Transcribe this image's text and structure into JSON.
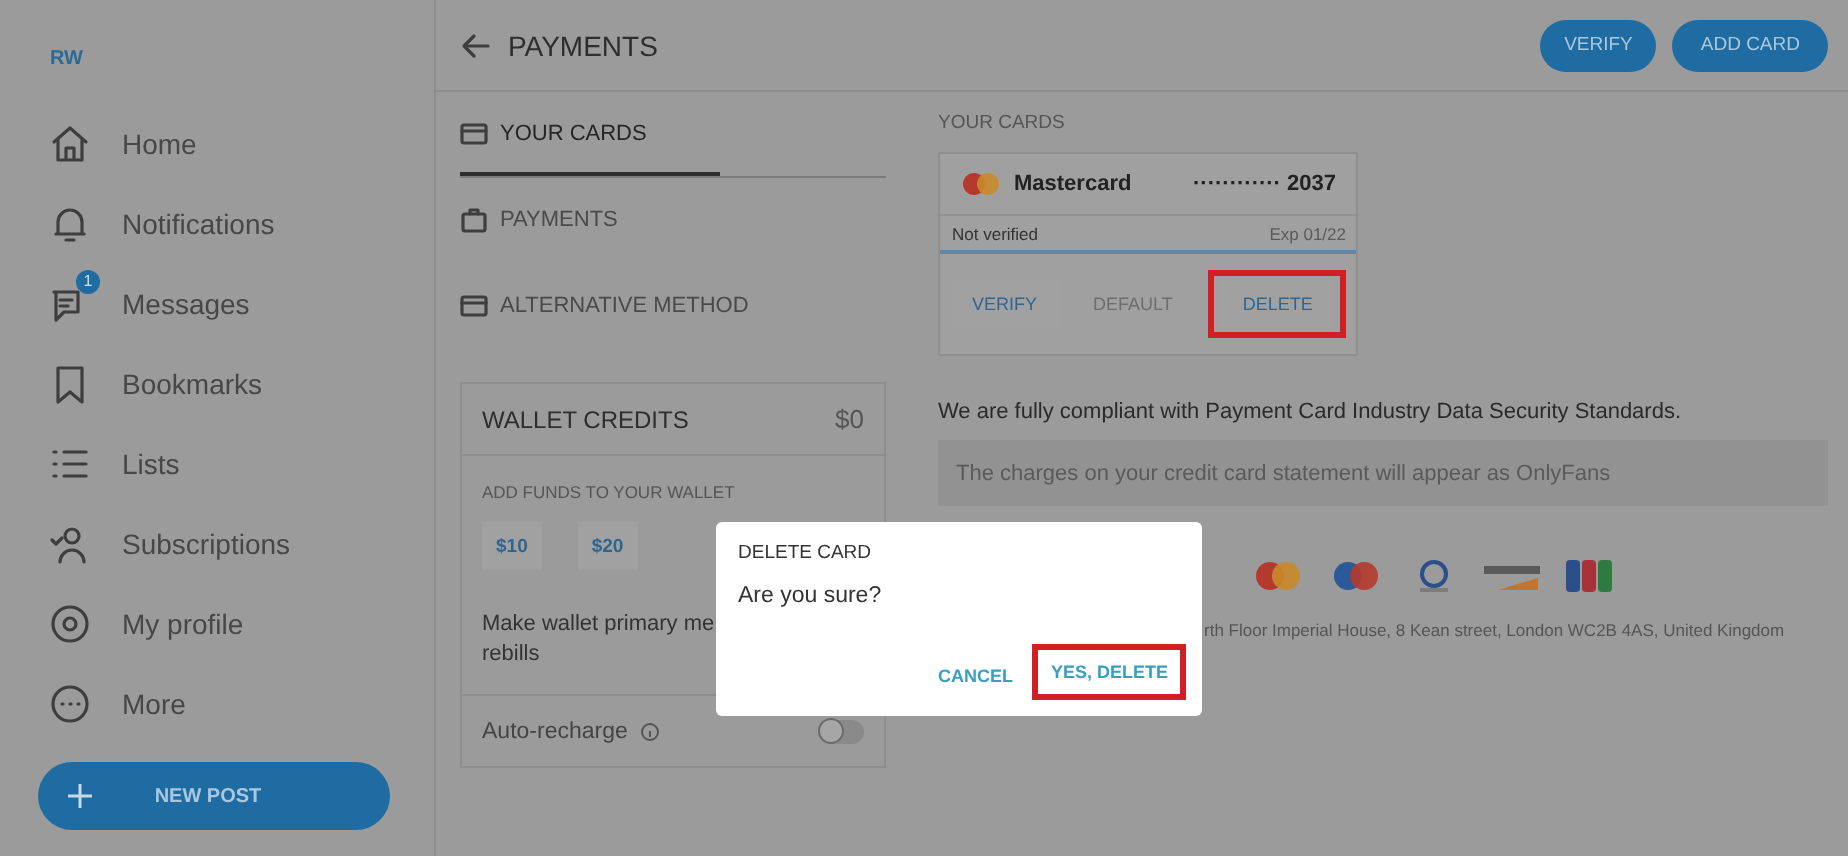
{
  "sidebar": {
    "avatar": "RW",
    "items": [
      {
        "kind": "home",
        "label": "Home"
      },
      {
        "kind": "bell",
        "label": "Notifications"
      },
      {
        "kind": "chat",
        "label": "Messages",
        "badge": "1"
      },
      {
        "kind": "bookmark",
        "label": "Bookmarks"
      },
      {
        "kind": "list",
        "label": "Lists"
      },
      {
        "kind": "person",
        "label": "Subscriptions"
      },
      {
        "kind": "profile",
        "label": "My profile"
      },
      {
        "kind": "more",
        "label": "More"
      }
    ],
    "new_post": "NEW POST"
  },
  "header": {
    "title": "PAYMENTS",
    "buttons": [
      "VERIFY",
      "ADD CARD"
    ]
  },
  "tabs": [
    {
      "kind": "card",
      "label": "YOUR CARDS",
      "selected": true
    },
    {
      "kind": "bag",
      "label": "PAYMENTS",
      "selected": false
    },
    {
      "kind": "card",
      "label": "ALTERNATIVE METHOD",
      "selected": false
    }
  ],
  "wallet": {
    "title": "WALLET CREDITS",
    "balance": "$0",
    "add_funds_label": "ADD FUNDS TO YOUR WALLET",
    "amounts": [
      "$10",
      "$20"
    ],
    "primary_text_lines": [
      "Make wallet primary me",
      "rebills"
    ],
    "auto_recharge": {
      "label": "Auto-recharge",
      "on": false
    }
  },
  "cards": {
    "title": "YOUR CARDS",
    "card": {
      "brand": "Mastercard",
      "number": "············ 2037",
      "status": "Not verified",
      "expiry": "Exp 01/22",
      "actions": [
        {
          "label": "VERIFY",
          "disabled": false,
          "highlighted": false
        },
        {
          "label": "DEFAULT",
          "disabled": true,
          "highlighted": false
        },
        {
          "label": "DELETE",
          "disabled": false,
          "highlighted": true
        }
      ]
    }
  },
  "compliance": "We are fully compliant with Payment Card Industry Data Security Standards.",
  "notice": "The charges on your credit card statement will appear as OnlyFans",
  "logos": [
    {
      "kind": "mastercard"
    },
    {
      "kind": "maestro"
    },
    {
      "kind": "diners"
    },
    {
      "kind": "discover"
    },
    {
      "kind": "jcb"
    }
  ],
  "address": "rth Floor Imperial House, 8 Kean street, London WC2B 4AS, United Kingdom",
  "dialog": {
    "title": "DELETE CARD",
    "message": "Are you sure?",
    "buttons": [
      {
        "label": "CANCEL",
        "highlighted": false
      },
      {
        "label": "YES, DELETE",
        "highlighted": true
      }
    ]
  }
}
